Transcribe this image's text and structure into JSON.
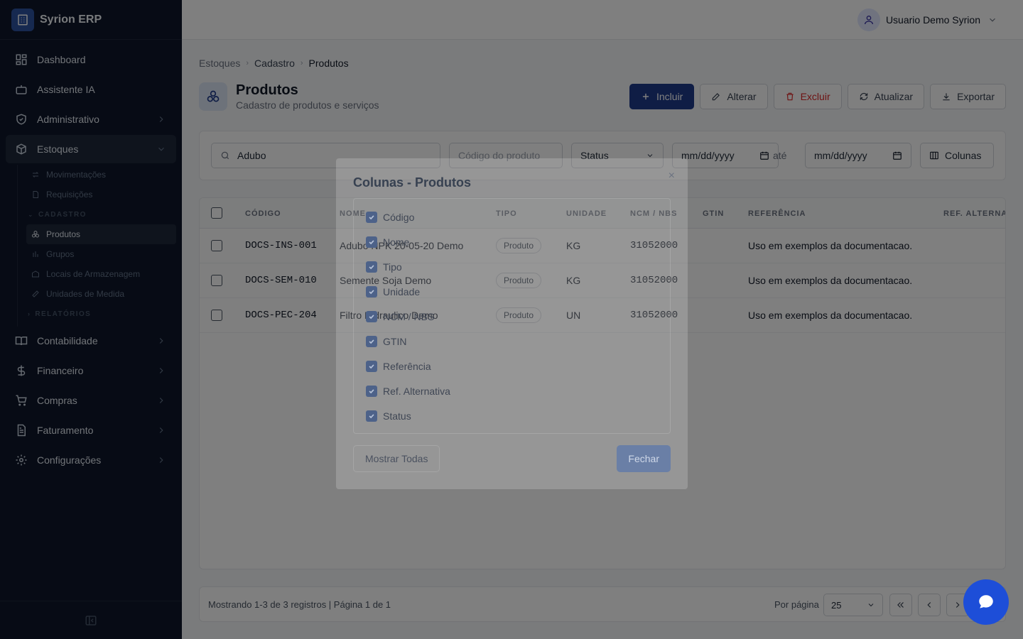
{
  "app": {
    "name": "Syrion ERP"
  },
  "user": {
    "name": "Usuario Demo Syrion"
  },
  "sidebar": {
    "items": [
      {
        "label": "Dashboard"
      },
      {
        "label": "Assistente IA"
      },
      {
        "label": "Administrativo"
      },
      {
        "label": "Estoques"
      },
      {
        "label": "Contabilidade"
      },
      {
        "label": "Financeiro"
      },
      {
        "label": "Compras"
      },
      {
        "label": "Faturamento"
      },
      {
        "label": "Configurações"
      }
    ],
    "estoques_sub": {
      "items": [
        "Movimentações",
        "Requisições"
      ],
      "cadastro_label": "CADASTRO",
      "cadastro_items": [
        "Produtos",
        "Grupos",
        "Locais de Armazenagem",
        "Unidades de Medida"
      ],
      "relatorios_label": "RELATÓRIOS"
    }
  },
  "breadcrumb": {
    "items": [
      "Estoques",
      "Cadastro",
      "Produtos"
    ]
  },
  "page": {
    "title": "Produtos",
    "subtitle": "Cadastro de produtos e serviços"
  },
  "actions": {
    "incluir": "Incluir",
    "alterar": "Alterar",
    "excluir": "Excluir",
    "atualizar": "Atualizar",
    "exportar": "Exportar"
  },
  "filters": {
    "search_value": "Adubo",
    "code_placeholder": "Código do produto",
    "status": "Status",
    "date_from": "mm/dd/yyyy",
    "ate": "até",
    "date_to": "mm/dd/yyyy",
    "columns_button": "Colunas"
  },
  "table": {
    "headers": [
      "CÓDIGO",
      "NOME",
      "TIPO",
      "UNIDADE",
      "NCM / NBS",
      "GTIN",
      "REFERÊNCIA",
      "REF. ALTERNA"
    ],
    "rows": [
      {
        "codigo": "DOCS-INS-001",
        "nome": "Adubo NPK 20-05-20 Demo",
        "tipo": "Produto",
        "unidade": "KG",
        "ncm": "31052000",
        "referencia": "Uso em exemplos da documentacao."
      },
      {
        "codigo": "DOCS-SEM-010",
        "nome": "Semente Soja Demo",
        "tipo": "Produto",
        "unidade": "KG",
        "ncm": "31052000",
        "referencia": "Uso em exemplos da documentacao."
      },
      {
        "codigo": "DOCS-PEC-204",
        "nome": "Filtro Hidraulico Demo",
        "tipo": "Produto",
        "unidade": "UN",
        "ncm": "31052000",
        "referencia": "Uso em exemplos da documentacao."
      }
    ]
  },
  "footer": {
    "info": "Mostrando 1-3 de 3 registros | Página 1 de 1",
    "per_page_label": "Por página",
    "per_page": "25"
  },
  "modal": {
    "title": "Colunas - Produtos",
    "close": "×",
    "columns": [
      "Código",
      "Nome",
      "Tipo",
      "Unidade",
      "NCM / NBS",
      "GTIN",
      "Referência",
      "Ref. Alternativa",
      "Status"
    ],
    "show_all": "Mostrar Todas",
    "close_button": "Fechar"
  },
  "colors": {
    "sidebar_bg": "#0f172a",
    "primary": "#1e3a8a",
    "danger": "#dc2626",
    "chat": "#1d4ed8"
  }
}
